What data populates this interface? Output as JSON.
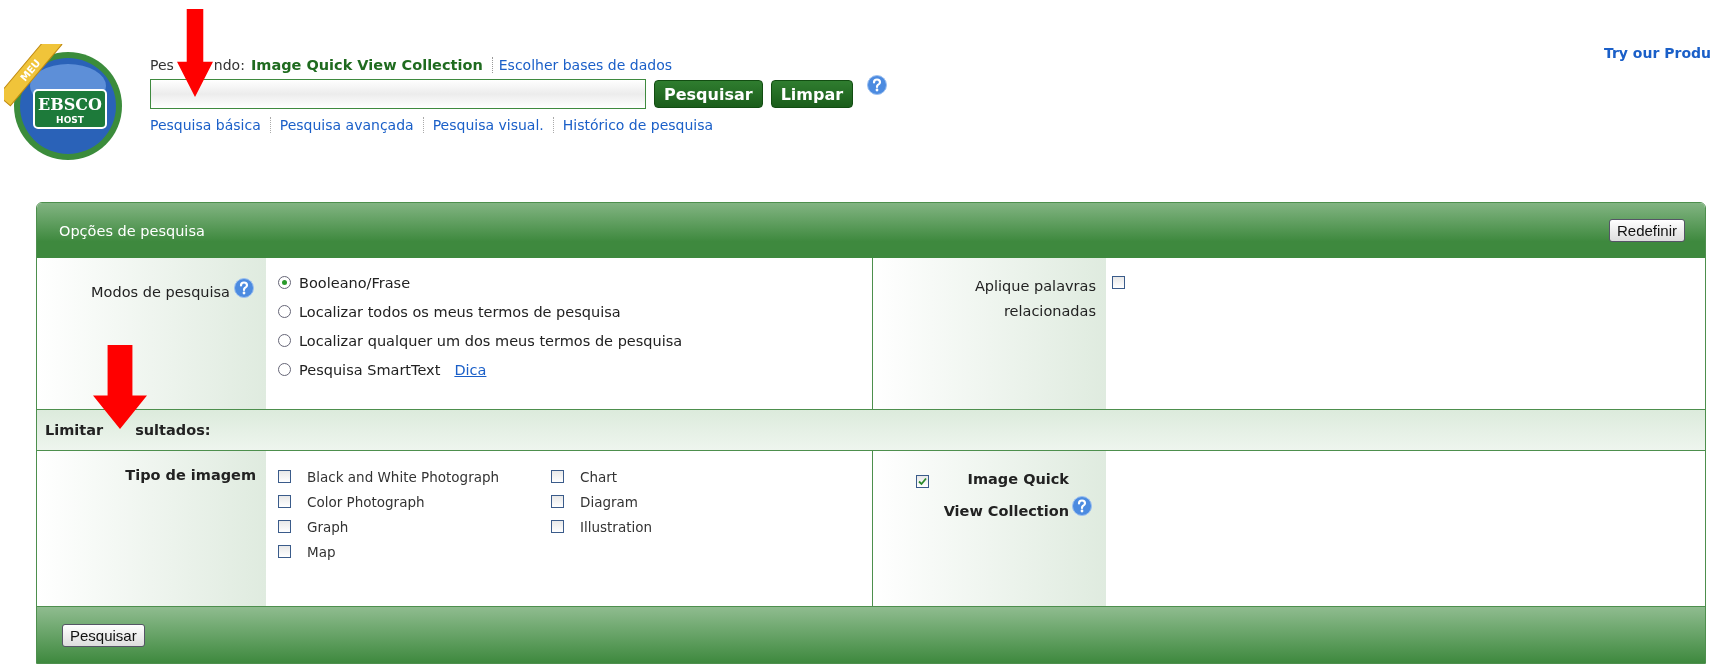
{
  "logo": {
    "badge": "MEU",
    "text": "EBSCO",
    "subtext": "HOST"
  },
  "search": {
    "searching_label": [
      "Pes",
      "ndo:"
    ],
    "database": "Image Quick View Collection",
    "choose_link": "Escolher bases de dados",
    "buttons": [
      "Pesquisar",
      "Limpar"
    ],
    "links": [
      "Pesquisa básica",
      "Pesquisa avançada",
      "Pesquisa visual.",
      "Histórico de pesquisa"
    ]
  },
  "promo_link": "Try our Produ",
  "options": {
    "title": "Opções de pesquisa",
    "reset_button": "Redefinir",
    "search_modes": {
      "label": "Modos de pesquisa",
      "options": [
        {
          "label": "Booleano/Frase",
          "selected": true
        },
        {
          "label": "Localizar todos os meus termos de pesquisa",
          "selected": false
        },
        {
          "label": "Localizar qualquer um dos meus termos de pesquisa",
          "selected": false
        },
        {
          "label": "Pesquisa SmartText",
          "selected": false,
          "link": "Dica"
        }
      ]
    },
    "related_words": {
      "label": "Aplique palavras relacionadas",
      "checked": false
    },
    "limit_title": [
      "Limitar",
      "sultados:"
    ],
    "image_type": {
      "label": "Tipo de imagem",
      "items": [
        {
          "label": "Black and White Photograph",
          "checked": false
        },
        {
          "label": "Color Photograph",
          "checked": false
        },
        {
          "label": "Graph",
          "checked": false
        },
        {
          "label": "Map",
          "checked": false
        },
        {
          "label": "Chart",
          "checked": false
        },
        {
          "label": "Diagram",
          "checked": false
        },
        {
          "label": "Illustration",
          "checked": false
        }
      ]
    },
    "collection": {
      "label": "Image Quick View Collection",
      "checked": true
    },
    "submit_button": "Pesquisar"
  }
}
